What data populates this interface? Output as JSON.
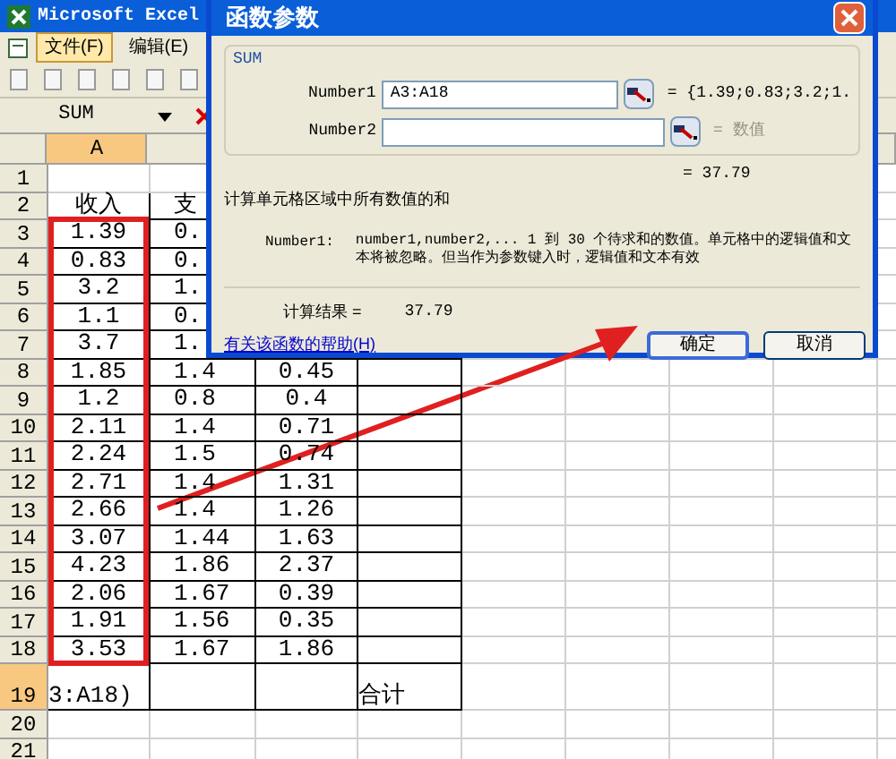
{
  "app_title": "Microsoft Excel",
  "menu": [
    {
      "label": "文件(F)",
      "selected": true
    },
    {
      "label": "编辑(E)",
      "selected": false
    }
  ],
  "name_box": "SUM",
  "columns": [
    {
      "label": "A",
      "selected": true
    }
  ],
  "rows": [
    {
      "header": "1",
      "selected": false,
      "cells": {}
    },
    {
      "header": "2",
      "selected": false,
      "cells": {
        "a": "收入",
        "b": "支"
      }
    },
    {
      "header": "3",
      "selected": false,
      "cells": {
        "a": "1.39",
        "b": "0."
      }
    },
    {
      "header": "4",
      "selected": false,
      "cells": {
        "a": "0.83",
        "b": "0."
      }
    },
    {
      "header": "5",
      "selected": false,
      "cells": {
        "a": "3.2",
        "b": "1."
      }
    },
    {
      "header": "6",
      "selected": false,
      "cells": {
        "a": "1.1",
        "b": "0."
      }
    },
    {
      "header": "7",
      "selected": false,
      "cells": {
        "a": "3.7",
        "b": "1."
      }
    },
    {
      "header": "8",
      "selected": false,
      "cells": {
        "a": "1.85",
        "b": "1.4",
        "c": "0.45"
      }
    },
    {
      "header": "9",
      "selected": false,
      "cells": {
        "a": "1.2",
        "b": "0.8",
        "c": "0.4"
      }
    },
    {
      "header": "10",
      "selected": false,
      "cells": {
        "a": "2.11",
        "b": "1.4",
        "c": "0.71"
      }
    },
    {
      "header": "11",
      "selected": false,
      "cells": {
        "a": "2.24",
        "b": "1.5",
        "c": "0.74"
      }
    },
    {
      "header": "12",
      "selected": false,
      "cells": {
        "a": "2.71",
        "b": "1.4",
        "c": "1.31"
      }
    },
    {
      "header": "13",
      "selected": false,
      "cells": {
        "a": "2.66",
        "b": "1.4",
        "c": "1.26"
      }
    },
    {
      "header": "14",
      "selected": false,
      "cells": {
        "a": "3.07",
        "b": "1.44",
        "c": "1.63"
      }
    },
    {
      "header": "15",
      "selected": false,
      "cells": {
        "a": "4.23",
        "b": "1.86",
        "c": "2.37"
      }
    },
    {
      "header": "16",
      "selected": false,
      "cells": {
        "a": "2.06",
        "b": "1.67",
        "c": "0.39"
      }
    },
    {
      "header": "17",
      "selected": false,
      "cells": {
        "a": "1.91",
        "b": "1.56",
        "c": "0.35"
      }
    },
    {
      "header": "18",
      "selected": false,
      "cells": {
        "a": "3.53",
        "b": "1.67",
        "c": "1.86"
      }
    },
    {
      "header": "19",
      "selected": true,
      "cells": {
        "a": "3:A18)",
        "d": "合计"
      }
    },
    {
      "header": "20",
      "selected": false,
      "cells": {}
    },
    {
      "header": "21",
      "selected": false,
      "cells": {}
    }
  ],
  "dialog": {
    "title": "函数参数",
    "function_name": "SUM",
    "args": [
      {
        "label": "Number1",
        "value": "A3:A18",
        "result": "= {1.39;0.83;3.2;1.",
        "result_disabled": false
      },
      {
        "label": "Number2",
        "result": "= 数值",
        "result_disabled": true
      }
    ],
    "formula_result": "= 37.79",
    "description": "计算单元格区域中所有数值的和",
    "arg_label": "Number1:",
    "arg_description": "number1,number2,... 1 到 30 个待求和的数值。单元格中的逻辑值和文本将被忽略。但当作为参数键入时，逻辑值和文本有效",
    "result_label": "计算结果 =",
    "result_value": "37.79",
    "help_link": "有关该函数的帮助(H)",
    "buttons": [
      {
        "label": "确定",
        "default": true
      },
      {
        "label": "取消",
        "default": false
      }
    ]
  }
}
